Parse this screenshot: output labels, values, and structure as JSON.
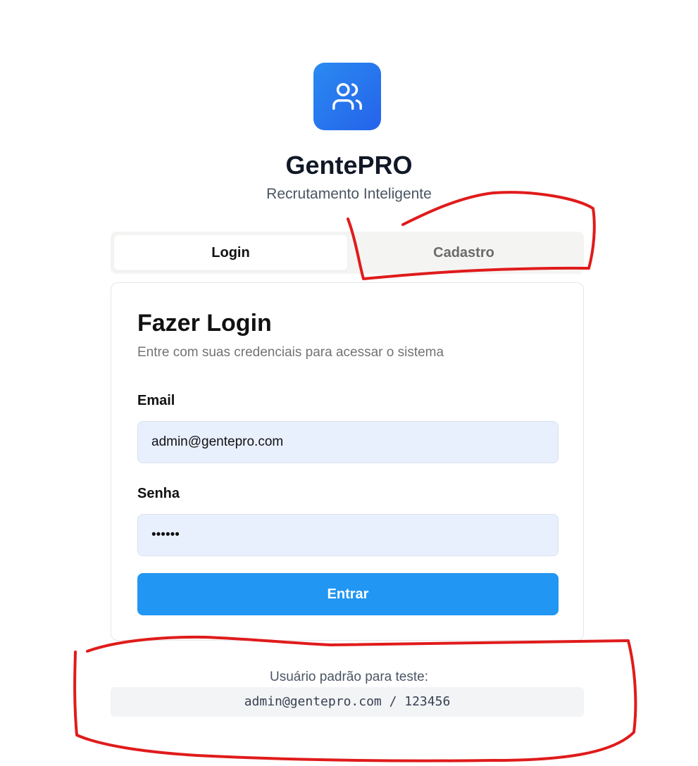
{
  "app": {
    "title": "GentePRO",
    "subtitle": "Recrutamento Inteligente",
    "logo_icon": "users-icon",
    "brand_color": "#2563eb"
  },
  "tabs": [
    {
      "label": "Login",
      "active": true
    },
    {
      "label": "Cadastro",
      "active": false
    }
  ],
  "login": {
    "title": "Fazer Login",
    "description": "Entre com suas credenciais para acessar o sistema",
    "email_label": "Email",
    "email_value": "admin@gentepro.com",
    "password_label": "Senha",
    "password_value": "123456",
    "submit_label": "Entrar"
  },
  "hint": {
    "label": "Usuário padrão para teste:",
    "credentials": "admin@gentepro.com / 123456"
  },
  "colors": {
    "button": "#2196f3",
    "input_bg": "#e8f0fe",
    "annotation": "#e01b1b"
  }
}
